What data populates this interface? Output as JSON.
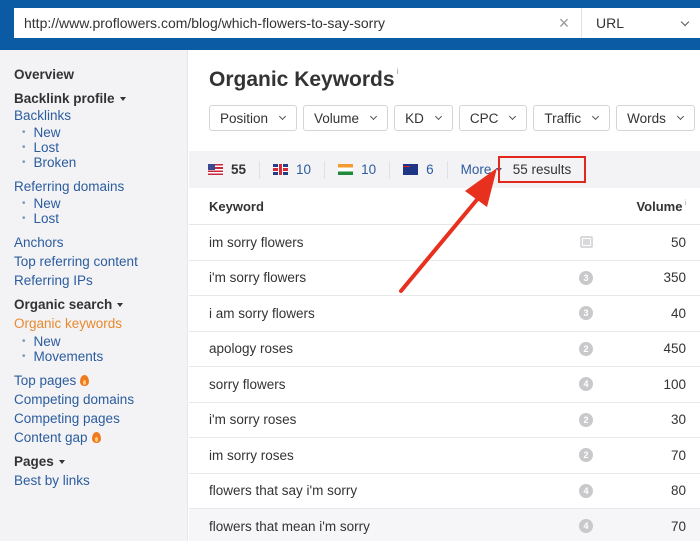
{
  "search": {
    "url_value": "http://www.proflowers.com/blog/which-flowers-to-say-sorry",
    "clear_icon": "×",
    "mode": "URL"
  },
  "sidebar": {
    "overview": "Overview",
    "backlink_profile": "Backlink profile",
    "backlinks": "Backlinks",
    "backlinks_sub": [
      "New",
      "Lost",
      "Broken"
    ],
    "referring_domains": "Referring domains",
    "referring_domains_sub": [
      "New",
      "Lost"
    ],
    "anchors": "Anchors",
    "top_referring_content": "Top referring content",
    "referring_ips": "Referring IPs",
    "organic_search": "Organic search",
    "organic_keywords": "Organic keywords",
    "organic_keywords_sub": [
      "New",
      "Movements"
    ],
    "top_pages": "Top pages",
    "competing_domains": "Competing domains",
    "competing_pages": "Competing pages",
    "content_gap": "Content gap",
    "pages": "Pages",
    "best_by_links": "Best by links"
  },
  "main": {
    "title": "Organic Keywords",
    "info_mark": "i",
    "filters": [
      "Position",
      "Volume",
      "KD",
      "CPC",
      "Traffic",
      "Words"
    ],
    "countries": [
      {
        "flag": "us-flag",
        "count": "55"
      },
      {
        "flag": "gb-flag",
        "count": "10"
      },
      {
        "flag": "in-flag",
        "count": "10"
      },
      {
        "flag": "au-flag",
        "count": "6"
      }
    ],
    "more_label": "More",
    "results_label": "55 results",
    "highlight_color": "#e0291c",
    "table": {
      "headers": {
        "keyword": "Keyword",
        "volume": "Volume"
      },
      "rows": [
        {
          "keyword": "im sorry flowers",
          "feature": "image",
          "volume": "50"
        },
        {
          "keyword": "i'm sorry flowers",
          "feature": "3",
          "volume": "350"
        },
        {
          "keyword": "i am sorry flowers",
          "feature": "3",
          "volume": "40"
        },
        {
          "keyword": "apology roses",
          "feature": "2",
          "volume": "450"
        },
        {
          "keyword": "sorry flowers",
          "feature": "4",
          "volume": "100"
        },
        {
          "keyword": "i'm sorry roses",
          "feature": "2",
          "volume": "30"
        },
        {
          "keyword": "im sorry roses",
          "feature": "2",
          "volume": "70"
        },
        {
          "keyword": "flowers that say i'm sorry",
          "feature": "4",
          "volume": "80"
        },
        {
          "keyword": "flowers that mean i'm sorry",
          "feature": "4",
          "volume": "70"
        }
      ]
    }
  }
}
